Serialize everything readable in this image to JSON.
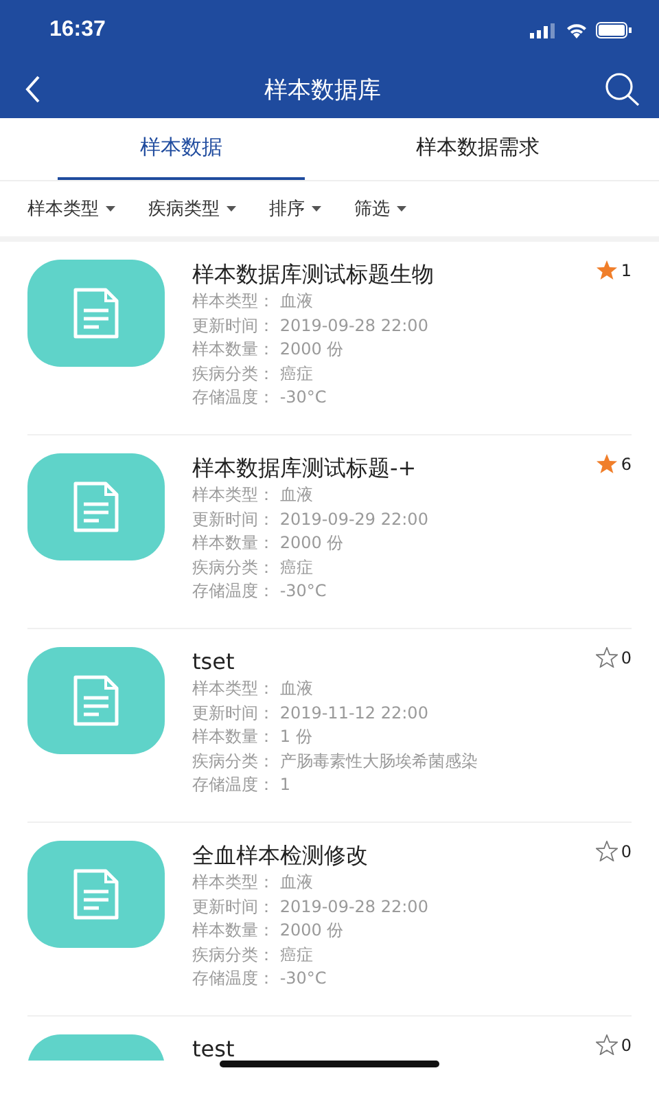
{
  "status_bar": {
    "time": "16:37"
  },
  "nav": {
    "title": "样本数据库"
  },
  "tabs": [
    {
      "label": "样本数据",
      "selected": true
    },
    {
      "label": "样本数据需求",
      "selected": false
    }
  ],
  "filters": [
    "样本类型",
    "疾病类型",
    "排序",
    "筛选"
  ],
  "items": [
    {
      "title": "样本数据库测试标题生物",
      "starred": true,
      "count": "1",
      "details": [
        "样本类型： 血液",
        "更新时间： 2019-09-28 22:00",
        "样本数量： 2000 份",
        "疾病分类： 癌症",
        "存储温度： -30°C"
      ]
    },
    {
      "title": "样本数据库测试标题-+",
      "starred": true,
      "count": "6",
      "details": [
        "样本类型： 血液",
        "更新时间： 2019-09-29 22:00",
        "样本数量： 2000 份",
        "疾病分类： 癌症",
        "存储温度： -30°C"
      ]
    },
    {
      "title": "tset",
      "starred": false,
      "count": "0",
      "details": [
        "样本类型： 血液",
        "更新时间： 2019-11-12 22:00",
        "样本数量： 1 份",
        "疾病分类： 产肠毒素性大肠埃希菌感染",
        "存储温度： 1"
      ]
    },
    {
      "title": "全血样本检测修改",
      "starred": false,
      "count": "0",
      "details": [
        "样本类型： 血液",
        "更新时间： 2019-09-28 22:00",
        "样本数量： 2000 份",
        "疾病分类： 癌症",
        "存储温度： -30°C"
      ]
    },
    {
      "title": "test",
      "starred": false,
      "count": "0"
    }
  ]
}
